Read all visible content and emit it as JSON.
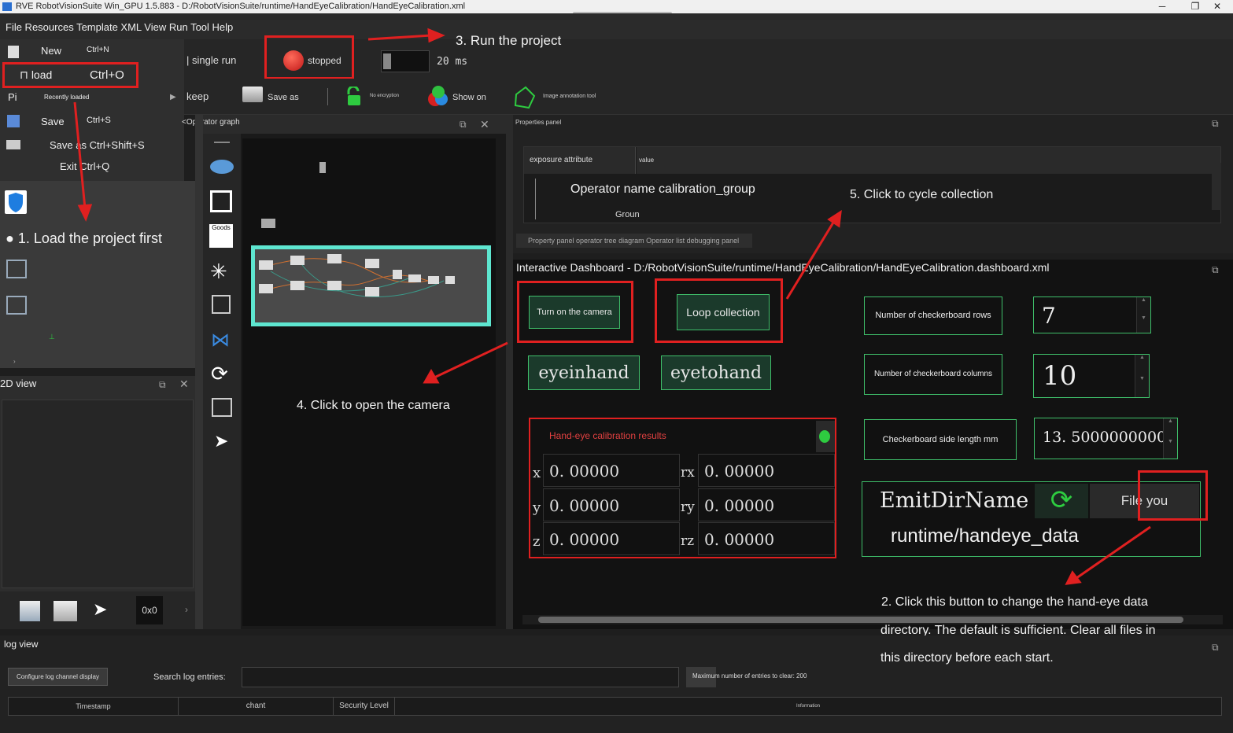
{
  "titlebar": {
    "title": "RVE RobotVisionSuite Win_GPU 1.5.883 - D:/RobotVisionSuite/runtime/HandEyeCalibration/HandEyeCalibration.xml",
    "min": "─",
    "max": "❐",
    "close": "✕"
  },
  "menubar": {
    "items": "File Resources Template XML View Run Tool Help"
  },
  "toolbar": {
    "single_run": "| single run",
    "stopped": "stopped",
    "interval_value": "20",
    "interval_unit": "ms",
    "keep": "keep",
    "save_as": "Save as",
    "no_encryption": "No encryption",
    "show_on": "Show on",
    "image_annotation": "Image annotation tool"
  },
  "filemenu": {
    "new": "New",
    "new_shortcut": "Ctrl+N",
    "load": "⊓ load",
    "load_shortcut": "Ctrl+O",
    "pi": "Pi",
    "recent": "Recently loaded",
    "save": "Save",
    "save_shortcut": "Ctrl+S",
    "save_as": "Save as Ctrl+Shift+S",
    "exit": "Exit Ctrl+Q"
  },
  "annotations": {
    "a1": "1. Load the project first",
    "a2_line1": "2. Click this button to change the hand-eye data",
    "a2_line2": "directory. The default is sufficient. Clear all files in",
    "a2_line3": "this directory before each start.",
    "a3": "3. Run the project",
    "a4": "4. Click to open the camera",
    "a5": "5. Click to cycle collection"
  },
  "view2d": {
    "title": "2D view",
    "zoom": "0x0"
  },
  "opgraph": {
    "title": "<Operator graph",
    "goods": "Goods"
  },
  "props": {
    "title": "Properties panel",
    "col1": "exposure attribute",
    "col2": "value",
    "row1": "Operator name calibration_group",
    "row2": "Groun",
    "tabs": "Property panel operator tree diagram Operator list debugging panel"
  },
  "dashboard": {
    "title": "Interactive Dashboard - D:/RobotVisionSuite/runtime/HandEyeCalibration/HandEyeCalibration.dashboard.xml",
    "turn_on_camera": "Turn on the camera",
    "loop_collection": "Loop collection",
    "eyeinhand": "eyeinhand",
    "eyetohand": "eyetohand",
    "rows_label": "Number of checkerboard rows",
    "rows_value": "7",
    "cols_label": "Number of checkerboard columns",
    "cols_value": "10",
    "side_label": "Checkerboard side length mm",
    "side_value": "13. 5000000000",
    "results_title": "Hand-eye calibration results",
    "x_label": "x",
    "x_value": "0. 00000",
    "y_label": "y",
    "y_value": "0. 00000",
    "z_label": "z",
    "z_value": "0. 00000",
    "rx_label": "rx",
    "rx_value": "0. 00000",
    "ry_label": "ry",
    "ry_value": "0. 00000",
    "rz_label": "rz",
    "rz_value": "0. 00000",
    "emit_label": "EmitDirName",
    "file_button": "File you",
    "dir_value": "runtime/handeye_data"
  },
  "logview": {
    "title": "log view",
    "configure": "Configure log channel display",
    "search_label": "Search log entries:",
    "max_entries": "Maximum number of entries to clear: 200",
    "col_timestamp": "Timestamp",
    "col_chant": "chant",
    "col_security": "Security Level",
    "col_information": "Information"
  },
  "colors": {
    "accent_green": "#3fbf6a",
    "annotation_red": "#e02020",
    "highlight_cyan": "#5ee6d0"
  }
}
